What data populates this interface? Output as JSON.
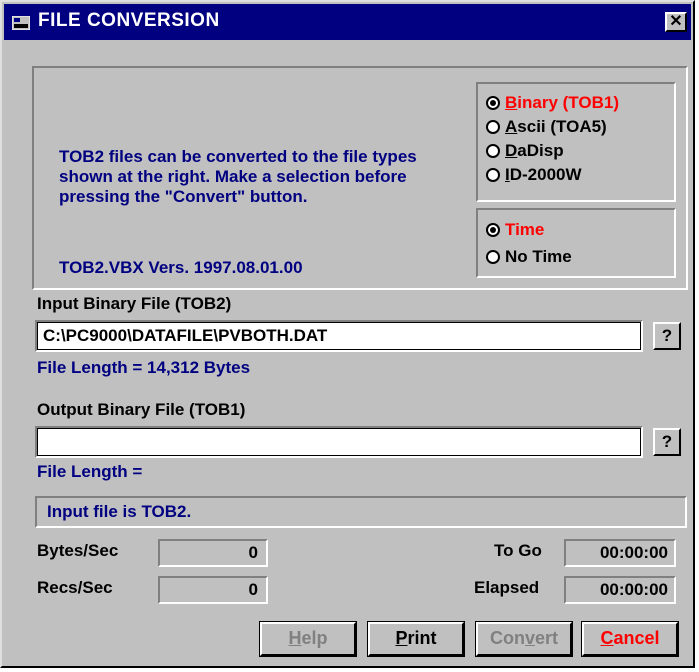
{
  "title": "FILE CONVERSION",
  "close_label": "✕",
  "description": "TOB2 files can be converted to the file types shown at the right. Make a selection before pressing the \"Convert\" button.",
  "version": "TOB2.VBX Vers. 1997.08.01.00",
  "format_options": [
    {
      "prefix": "",
      "key": "B",
      "rest": "inary (TOB1)",
      "selected": true
    },
    {
      "prefix": "",
      "key": "A",
      "rest": "scii (TOA5)",
      "selected": false
    },
    {
      "prefix": "",
      "key": "D",
      "rest": "aDisp",
      "selected": false
    },
    {
      "prefix": "",
      "key": "I",
      "rest": "D-2000W",
      "selected": false
    }
  ],
  "time_options": [
    {
      "label": "Time",
      "selected": true
    },
    {
      "label": "No Time",
      "selected": false
    }
  ],
  "input": {
    "label": "Input Binary File (TOB2)",
    "value": "C:\\PC9000\\DATAFILE\\PVBOTH.DAT",
    "length_text": "File Length = 14,312 Bytes",
    "browse_label": "?"
  },
  "output": {
    "label": "Output Binary File (TOB1)",
    "value": "",
    "length_text": "File Length =",
    "browse_label": "?"
  },
  "status_message": "Input file is TOB2.",
  "stats": {
    "bytes_label": "Bytes/Sec",
    "bytes_value": "0",
    "recs_label": "Recs/Sec",
    "recs_value": "0",
    "togo_label": "To Go",
    "togo_value": "00:00:00",
    "elapsed_label": "Elapsed",
    "elapsed_value": "00:00:00"
  },
  "buttons": {
    "help": {
      "key": "H",
      "rest": "elp"
    },
    "print": {
      "key": "P",
      "rest": "rint"
    },
    "convert": {
      "prefix": "Con",
      "key": "v",
      "rest": "ert"
    },
    "cancel": {
      "key": "C",
      "rest": "ancel"
    }
  },
  "colors": {
    "titlebar": "#000080",
    "accent_red": "#ff0000",
    "text_blue": "#000080"
  }
}
